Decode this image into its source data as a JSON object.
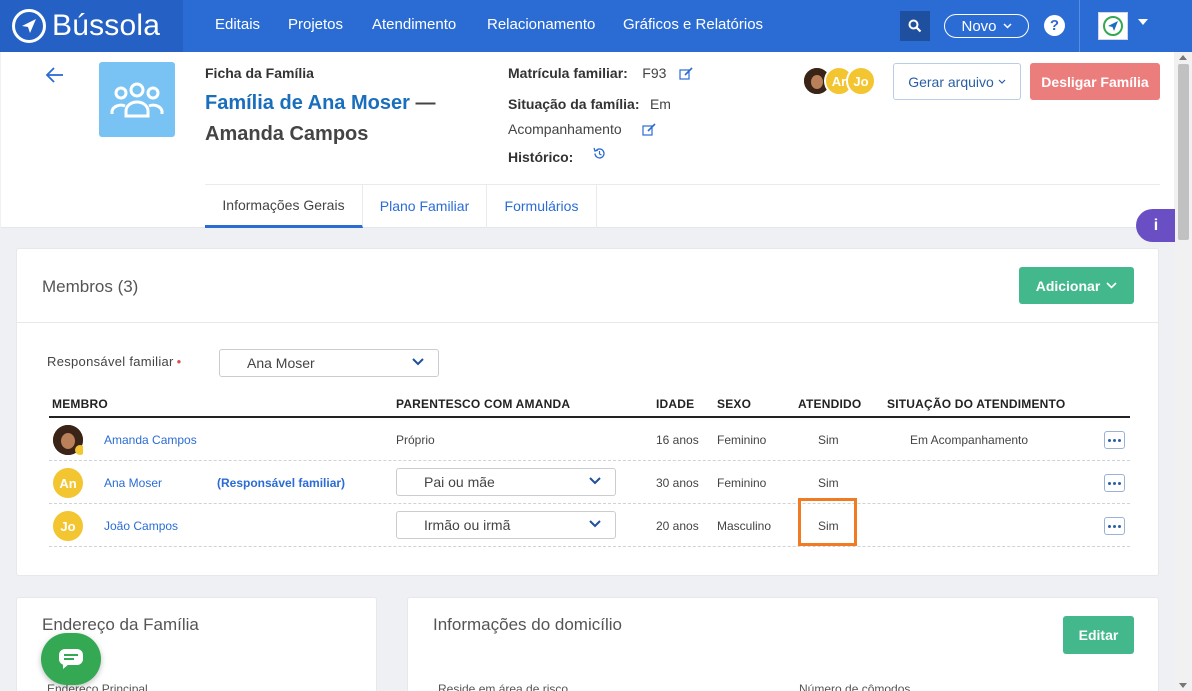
{
  "brand": {
    "name": "Bússola"
  },
  "nav": {
    "items": [
      "Editais",
      "Projetos",
      "Atendimento",
      "Relacionamento",
      "Gráficos e Relatórios"
    ],
    "novo_label": "Novo",
    "help_label": "?"
  },
  "header": {
    "ficha_label": "Ficha da Família",
    "family_name": "Família de Ana Moser",
    "dash": "—",
    "member_name": "Amanda Campos",
    "matricula_label": "Matrícula familiar:",
    "matricula_value": "F93",
    "situacao_label": "Situação da família:",
    "situacao_value_1": "Em",
    "situacao_value_2": "Acompanhamento",
    "historico_label": "Histórico:",
    "avatars": [
      "Ar",
      "Jo"
    ],
    "gerar_label": "Gerar arquivo",
    "desligar_label": "Desligar Família"
  },
  "tabs": [
    "Informações Gerais",
    "Plano Familiar",
    "Formulários"
  ],
  "info_float_label": "i",
  "members": {
    "title": "Membros (3)",
    "add_label": "Adicionar",
    "responsavel_label": "Responsável familiar",
    "responsavel_required": "•",
    "responsavel_value": "Ana Moser",
    "columns": [
      "MEMBRO",
      "PARENTESCO COM AMANDA",
      "IDADE",
      "SEXO",
      "ATENDIDO",
      "SITUAÇÃO DO ATENDIMENTO"
    ],
    "rows": [
      {
        "initials": "",
        "name": "Amanda Campos",
        "tag": "",
        "parentesco": "Próprio",
        "idade": "16 anos",
        "sexo": "Feminino",
        "atendido": "Sim",
        "situacao": "Em Acompanhamento"
      },
      {
        "initials": "An",
        "name": "Ana Moser",
        "tag": "(Responsável familiar)",
        "parentesco": "Pai ou mãe",
        "idade": "30 anos",
        "sexo": "Feminino",
        "atendido": "Sim",
        "situacao": ""
      },
      {
        "initials": "Jo",
        "name": "João Campos",
        "tag": "",
        "parentesco": "Irmão ou irmã",
        "idade": "20 anos",
        "sexo": "Masculino",
        "atendido": "Sim",
        "situacao": ""
      }
    ]
  },
  "address": {
    "title": "Endereço da Família",
    "sub_label": "Endereço Principal"
  },
  "home": {
    "title": "Informações do domicílio",
    "edit_label": "Editar",
    "risk_label": "Reside em área de risco",
    "rooms_label": "Número de cômodos"
  },
  "colors": {
    "primary": "#2b6cd4",
    "success": "#43b88d",
    "danger": "#ec7d7d",
    "highlight": "#f07b22"
  }
}
